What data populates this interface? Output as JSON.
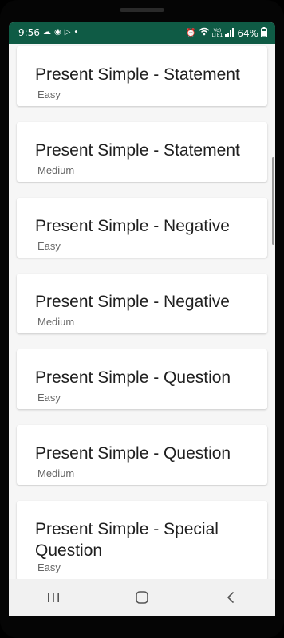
{
  "status_bar": {
    "time": "9:56",
    "battery": "64%",
    "network_top": "Vo)",
    "network_bottom": "LTE1"
  },
  "lessons": [
    {
      "title": "Present Simple - Statement",
      "level": "Easy"
    },
    {
      "title": "Present Simple - Statement",
      "level": "Medium"
    },
    {
      "title": "Present Simple - Negative",
      "level": "Easy"
    },
    {
      "title": "Present Simple - Negative",
      "level": "Medium"
    },
    {
      "title": "Present Simple - Question",
      "level": "Easy"
    },
    {
      "title": "Present Simple - Question",
      "level": "Medium"
    },
    {
      "title": "Present Simple - Special Question",
      "level": "Easy"
    }
  ],
  "nav": {
    "recents": "recents-icon",
    "home": "home-icon",
    "back": "back-icon"
  },
  "colors": {
    "status_bar": "#0f5b45",
    "background": "#f4f4f4",
    "card": "#ffffff"
  }
}
